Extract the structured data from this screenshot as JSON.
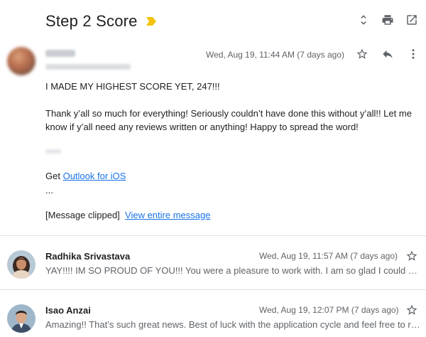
{
  "subject": "Step 2 Score",
  "colors": {
    "importance": "#f4c20d",
    "link": "#1a73e8",
    "muted": "#5f6368"
  },
  "top_icons": [
    "expand-collapse-icon",
    "print-icon",
    "open-in-new-window-icon"
  ],
  "message1": {
    "date": "Wed, Aug 19, 11:44 AM (7 days ago)",
    "body_line1": "I MADE MY HIGHEST SCORE YET, 247!!!",
    "body_line2": "Thank y’all so much for everything! Seriously couldn’t have done this without y’all!! Let me know if y’all need any reviews written or anything! Happy to spread the word!",
    "outlook_prefix": "Get ",
    "outlook_link": "Outlook for iOS",
    "ellipsis": "...",
    "clipped_text": "[Message clipped]",
    "view_entire": "View entire message"
  },
  "collapsed_messages": [
    {
      "name": "Radhika Srivastava",
      "date": "Wed, Aug 19, 11:57 AM (7 days ago)",
      "snippet": "YAY!!!! IM SO PROUD OF YOU!!! You were a pleasure to work with. I am so glad I could help you reach your goal!"
    },
    {
      "name": "Isao Anzai",
      "date": "Wed, Aug 19, 12:07 PM (7 days ago)",
      "snippet": "Amazing!! That’s such great news. Best of luck with the application cycle and feel free to reach out anytime!"
    }
  ]
}
